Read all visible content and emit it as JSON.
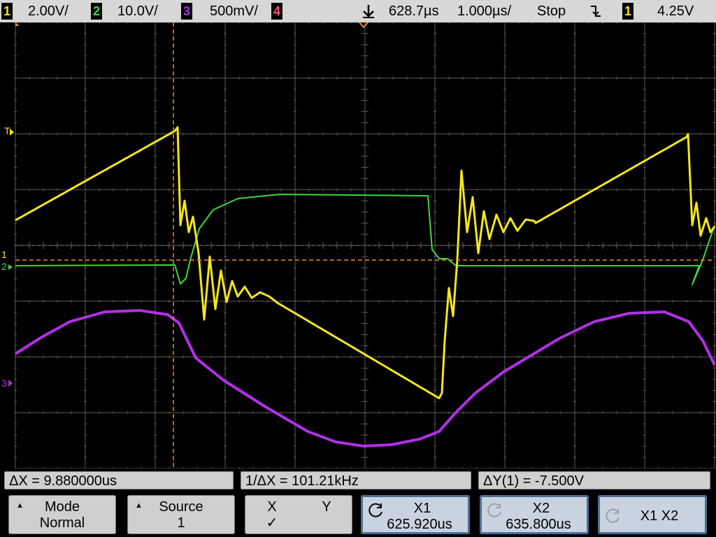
{
  "header": {
    "ch1": {
      "num": "1",
      "scale": "2.00V/",
      "color": "#f5e61c"
    },
    "ch2": {
      "num": "2",
      "scale": "10.0V/",
      "color": "#3cd93c"
    },
    "ch3": {
      "num": "3",
      "scale": "500mV/",
      "color": "#b030e6"
    },
    "ch4": {
      "num": "4",
      "color": "#ff4f7b"
    },
    "delay": "628.7µs",
    "timebase": "1.000µs/",
    "run_state": "Stop",
    "trigger": {
      "slope_icon": "falling-edge-icon",
      "source": "1",
      "level": "4.25V"
    }
  },
  "screen": {
    "ch1_marker": "1",
    "ch2_marker": "2",
    "ch3_marker": "3",
    "trig_marker": "T",
    "colors": {
      "background": "#000000",
      "grid": "#5a5a5a",
      "cursor": "#e8893a",
      "ch1": "#f5e61c",
      "ch2": "#3cd93c",
      "ch3": "#b030e6"
    }
  },
  "cursors": {
    "delta_x": "ΔX = 9.880000us",
    "inv_delta_x": "1/ΔX = 101.21kHz",
    "delta_y": "ΔY(1) = -7.500V"
  },
  "softkeys": {
    "mode": {
      "title": "Mode",
      "value": "Normal"
    },
    "source": {
      "title": "Source",
      "value": "1"
    },
    "xy": {
      "x": "X",
      "y": "Y",
      "check": "✓"
    },
    "x1": {
      "title": "X1",
      "value": "625.920us"
    },
    "x2": {
      "title": "X2",
      "value": "635.800us"
    },
    "x1x2": {
      "title": "X1 X2"
    }
  }
}
